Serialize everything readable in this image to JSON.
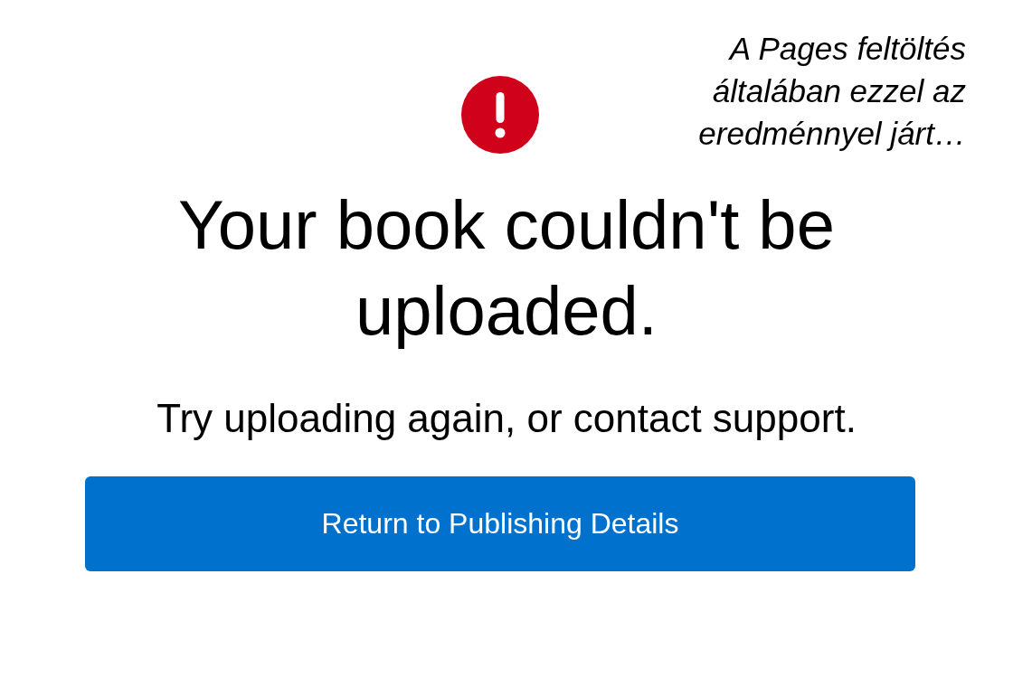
{
  "caption": "A Pages feltöltés általában ezzel az eredménnyel járt…",
  "error": {
    "kind": "error",
    "title": "Your book couldn't be uploaded.",
    "message": "Try uploading again, or contact support."
  },
  "button": {
    "label": "Return to Publishing Details"
  }
}
